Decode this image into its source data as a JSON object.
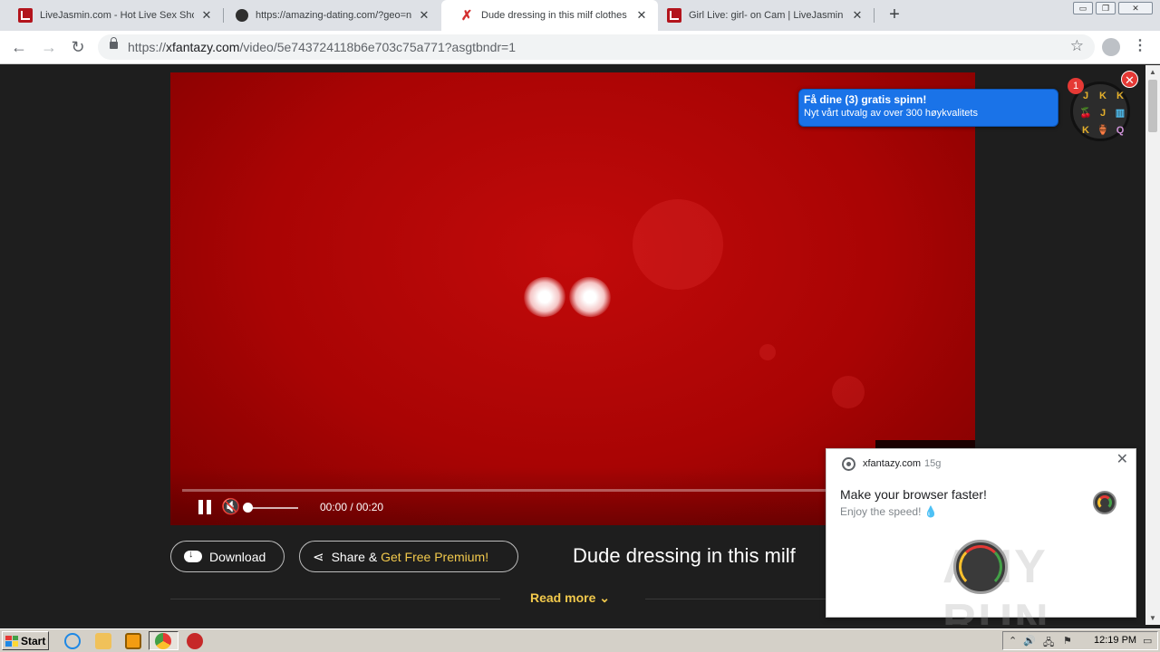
{
  "browser": {
    "tabs": [
      {
        "title": "LiveJasmin.com - Hot Live Sex Shows",
        "favicon": "livejasmin-icon",
        "active": false
      },
      {
        "title": "https://amazing-dating.com/?geo=n",
        "favicon": "dating-site-icon",
        "active": false
      },
      {
        "title": "Dude dressing in this milf clothes and",
        "favicon": "xfantazy-icon",
        "active": true
      },
      {
        "title": "Girl Live: girl- on Cam | LiveJasmin",
        "favicon": "livejasmin-icon",
        "active": false
      }
    ],
    "new_tab_label": "+",
    "window_controls": {
      "minimize": "▭",
      "restore": "❐",
      "close": "✕"
    },
    "url": {
      "scheme": "https://",
      "host": "xfantazy.com",
      "path": "/video/5e743724118b6e703c75a771?asgtbndr=1"
    }
  },
  "player": {
    "time_current": "00:00",
    "time_separator": " / ",
    "time_total": "00:20",
    "progress_fraction": 0,
    "volume_fraction": 0
  },
  "actions": {
    "download_label": "Download",
    "share_label": "Share & ",
    "share_accent": "Get Free Premium!",
    "read_more_label": "Read more"
  },
  "video": {
    "title": "Dude dressing in this milf"
  },
  "ad": {
    "line1": "Få dine (3) gratis spinn!",
    "line2": "Nyt vårt utvalg av over 300 høykvalitets",
    "badge": "1",
    "close": "✕",
    "symbols": [
      "J",
      "K",
      "K",
      "🍒",
      "J",
      "▥",
      "K",
      "🏺",
      "Q"
    ]
  },
  "notification": {
    "site": "xfantazy.com",
    "age": "15g",
    "title": "Make your browser faster!",
    "body": "Enjoy the speed! 💧",
    "close": "✕"
  },
  "watermark": "ANY RUN",
  "taskbar": {
    "start_label": "Start",
    "clock": "12:19 PM"
  },
  "colors": {
    "accent_yellow": "#f2c94c",
    "player_red": "#b30404",
    "ad_blue": "#1a73e8"
  }
}
